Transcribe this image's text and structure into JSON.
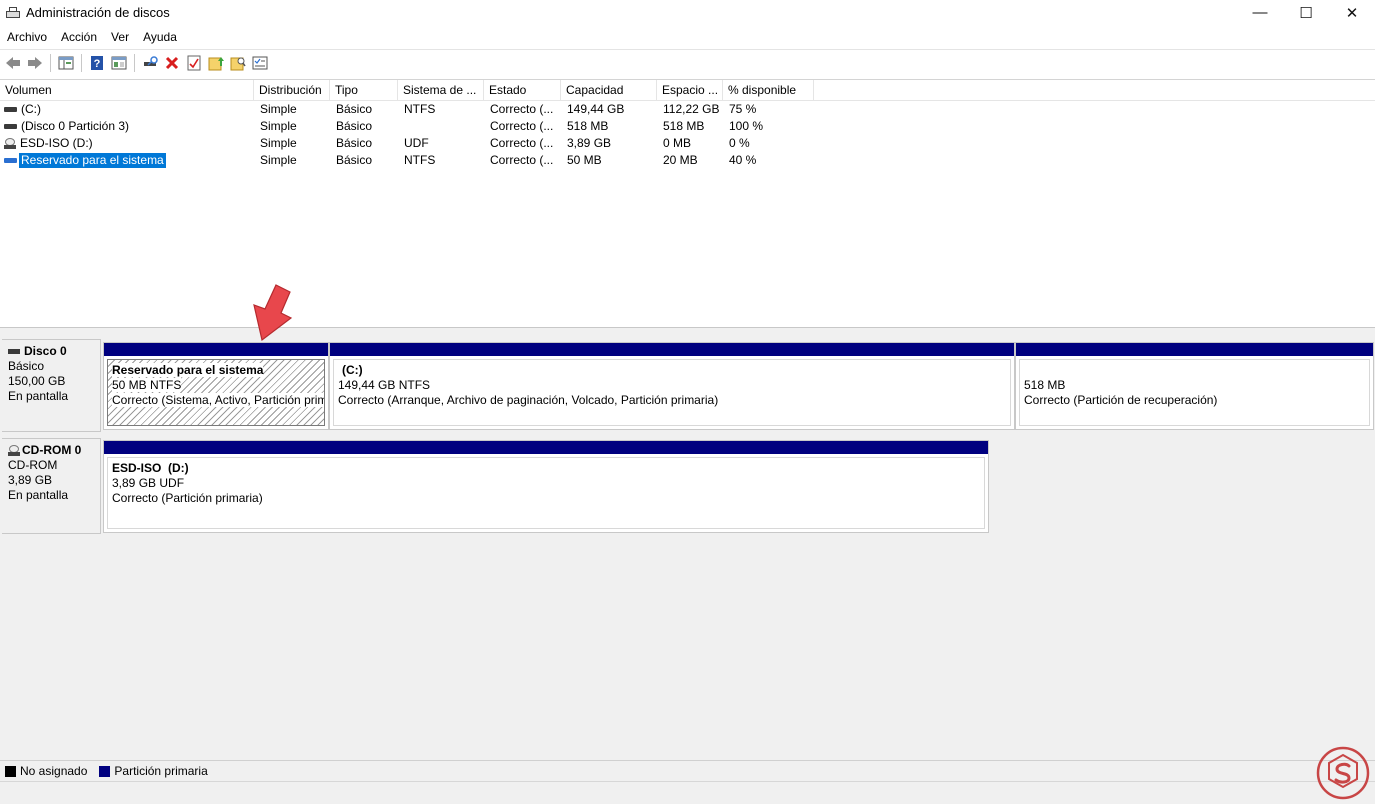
{
  "window": {
    "title": "Administración de discos",
    "minimize": "—",
    "maximize": "☐",
    "close": "✕"
  },
  "menu": [
    "Archivo",
    "Acción",
    "Ver",
    "Ayuda"
  ],
  "toolbar": [
    "back-icon",
    "forward-icon",
    "console-tree-icon",
    "help-icon",
    "details-pane-icon",
    "connect-icon",
    "delete-icon",
    "properties-icon",
    "up-folder-icon",
    "find-icon",
    "view-icon"
  ],
  "columns": [
    "Volumen",
    "Distribución",
    "Tipo",
    "Sistema de ...",
    "Estado",
    "Capacidad",
    "Espacio ...",
    "% disponible"
  ],
  "volumes": [
    {
      "icon": "disk-icon",
      "name": "(C:)",
      "layout": "Simple",
      "type": "Básico",
      "fs": "NTFS",
      "status": "Correcto (...",
      "capacity": "149,44 GB",
      "free": "112,22 GB",
      "pct": "75 %"
    },
    {
      "icon": "disk-icon",
      "name": "(Disco 0 Partición 3)",
      "layout": "Simple",
      "type": "Básico",
      "fs": "",
      "status": "Correcto (...",
      "capacity": "518 MB",
      "free": "518 MB",
      "pct": "100 %"
    },
    {
      "icon": "cd-icon",
      "name": "ESD-ISO (D:)",
      "layout": "Simple",
      "type": "Básico",
      "fs": "UDF",
      "status": "Correcto (...",
      "capacity": "3,89 GB",
      "free": "0 MB",
      "pct": "0 %"
    },
    {
      "icon": "disk-icon",
      "name": "Reservado para el sistema",
      "layout": "Simple",
      "type": "Básico",
      "fs": "NTFS",
      "status": "Correcto (...",
      "capacity": "50 MB",
      "free": "20 MB",
      "pct": "40 %"
    }
  ],
  "disks": [
    {
      "name": "Disco 0",
      "kind": "Básico",
      "size": "150,00 GB",
      "state": "En pantalla",
      "partitions": [
        {
          "title": "Reservado para el sistema",
          "size": "50 MB NTFS",
          "status": "Correcto (Sistema, Activo, Partición primaria)"
        },
        {
          "title": "(C:)",
          "size": "149,44 GB NTFS",
          "status": "Correcto (Arranque, Archivo de paginación, Volcado, Partición primaria)"
        },
        {
          "title": "",
          "size": "518 MB",
          "status": "Correcto (Partición de recuperación)"
        }
      ]
    },
    {
      "name": "CD-ROM 0",
      "kind": "CD-ROM",
      "size": "3,89 GB",
      "state": "En pantalla",
      "partitions": [
        {
          "title": "ESD-ISO  (D:)",
          "size": "3,89 GB UDF",
          "status": "Correcto (Partición primaria)"
        }
      ]
    }
  ],
  "legend": [
    {
      "label": "No asignado",
      "color": "#000000"
    },
    {
      "label": "Partición primaria",
      "color": "#00007f"
    }
  ],
  "colors": {
    "primary_partition_bar": "#00007f",
    "selection": "#0078d7",
    "annotation_arrow": "#e8474c",
    "watermark": "#c84646"
  }
}
